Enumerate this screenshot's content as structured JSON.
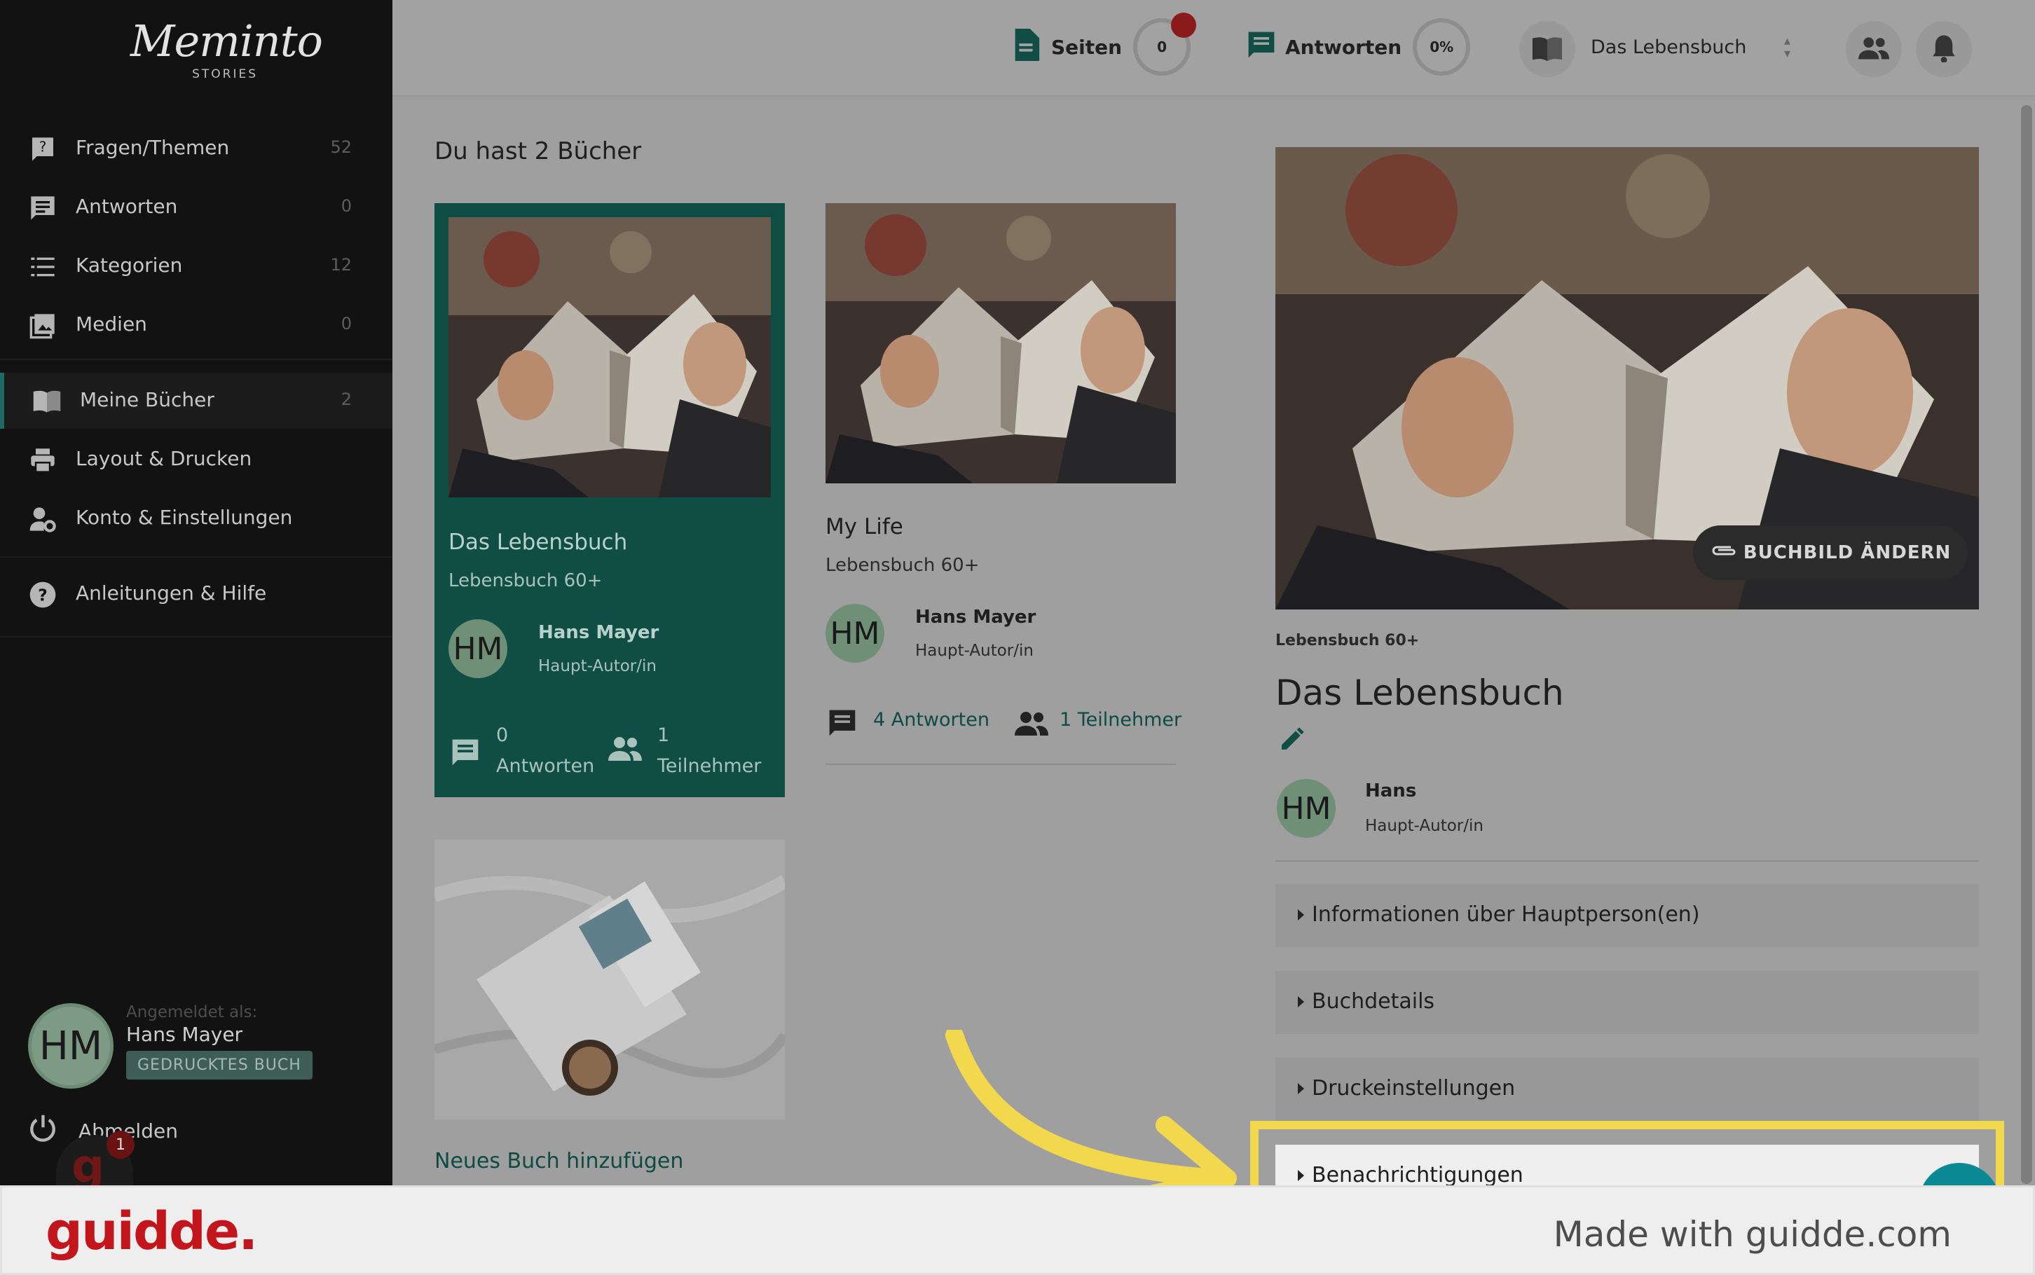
{
  "app": {
    "logo_script": "Meminto",
    "logo_sub": "STORIES"
  },
  "sidebar": {
    "items": [
      {
        "label": "Fragen/Themen",
        "count": "52",
        "icon": "question-icon"
      },
      {
        "label": "Antworten",
        "count": "0",
        "icon": "comment-icon"
      },
      {
        "label": "Kategorien",
        "count": "12",
        "icon": "list-icon"
      },
      {
        "label": "Medien",
        "count": "0",
        "icon": "image-icon"
      },
      {
        "label": "Meine Bücher",
        "count": "2",
        "icon": "book-icon",
        "active": true
      },
      {
        "label": "Layout & Drucken",
        "count": "",
        "icon": "printer-icon"
      },
      {
        "label": "Konto & Einstellungen",
        "count": "",
        "icon": "account-settings-icon"
      },
      {
        "label": "Anleitungen & Hilfe",
        "count": "",
        "icon": "help-icon"
      }
    ],
    "user": {
      "logged_as": "Angemeldet als:",
      "initials": "HM",
      "name": "Hans Mayer",
      "badge": "GEDRUCKTES BUCH"
    },
    "logout": "Abmelden",
    "notif_count": "1"
  },
  "topbar": {
    "pages_label": "Seiten",
    "pages_value": "0",
    "answers_label": "Antworten",
    "answers_value": "0%",
    "book_select": "Das Lebensbuch"
  },
  "main": {
    "heading": "Du hast 2 Bücher",
    "books": [
      {
        "title": "Das Lebensbuch",
        "category": "Lebensbuch 60+",
        "initials": "HM",
        "author": "Hans Mayer",
        "role": "Haupt-Autor/in",
        "answers_count": "0",
        "answers_label": "Antworten",
        "participants_count": "1",
        "participants_label": "Teilnehmer"
      },
      {
        "title": "My Life",
        "category": "Lebensbuch 60+",
        "initials": "HM",
        "author": "Hans Mayer",
        "role": "Haupt-Autor/in",
        "answers": "4 Antworten",
        "participants": "1 Teilnehmer"
      }
    ],
    "new_book": "Neues Buch hinzufügen"
  },
  "detail": {
    "change_image": "BUCHBILD ÄNDERN",
    "category": "Lebensbuch 60+",
    "title": "Das Lebensbuch",
    "initials": "HM",
    "author": "Hans",
    "role": "Haupt-Autor/in",
    "sections": [
      "Informationen über Hauptperson(en)",
      "Buchdetails",
      "Druckeinstellungen",
      "Benachrichtigungen"
    ]
  },
  "footer": {
    "brand": "guidde.",
    "made_with": "Made with guidde.com"
  },
  "colors": {
    "accent": "#0f4d45",
    "highlight": "#f2d84d",
    "brand_red": "#c3161c"
  }
}
